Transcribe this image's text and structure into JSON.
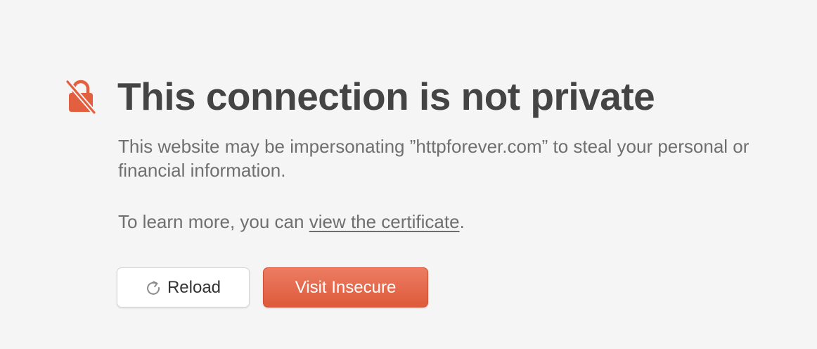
{
  "warning": {
    "title": "This connection is not private",
    "description": "This website may be impersonating ”httpforever.com” to steal your personal or financial information.",
    "learn_more_prefix": "To learn more, you can ",
    "certificate_link": "view the certificate",
    "learn_more_suffix": "."
  },
  "buttons": {
    "reload_label": "Reload",
    "visit_label": "Visit Insecure"
  },
  "icons": {
    "lock": "insecure-lock-icon",
    "reload": "reload-icon"
  },
  "colors": {
    "accent": "#e2603f",
    "title_text": "#444444",
    "body_text": "#6f6f6f",
    "background": "#f5f5f5"
  }
}
